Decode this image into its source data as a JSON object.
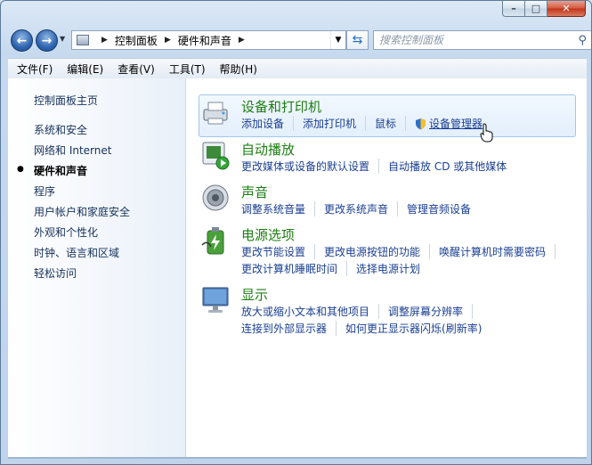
{
  "window": {
    "caption_buttons": [
      "–",
      "□",
      "✕"
    ]
  },
  "nav": {
    "back_icon": "back-arrow-icon",
    "forward_icon": "forward-arrow-icon",
    "breadcrumb": [
      "控制面板",
      "硬件和声音"
    ],
    "search_placeholder": "搜索控制面板"
  },
  "menu": [
    "文件(F)",
    "编辑(E)",
    "查看(V)",
    "工具(T)",
    "帮助(H)"
  ],
  "sidebar": {
    "home": "控制面板主页",
    "items": [
      "系统和安全",
      "网络和 Internet",
      "硬件和声音",
      "程序",
      "用户帐户和家庭安全",
      "外观和个性化",
      "时钟、语言和区域",
      "轻松访问"
    ],
    "current_index": 2
  },
  "categories": [
    {
      "title": "设备和打印机",
      "icon": "printer-icon",
      "rows": [
        [
          "添加设备",
          "添加打印机",
          "鼠标",
          "设备管理器"
        ]
      ]
    },
    {
      "title": "自动播放",
      "icon": "autoplay-icon",
      "rows": [
        [
          "更改媒体或设备的默认设置",
          "自动播放 CD 或其他媒体"
        ]
      ]
    },
    {
      "title": "声音",
      "icon": "speaker-icon",
      "rows": [
        [
          "调整系统音量",
          "更改系统声音",
          "管理音频设备"
        ]
      ]
    },
    {
      "title": "电源选项",
      "icon": "battery-icon",
      "rows": [
        [
          "更改节能设置",
          "更改电源按钮的功能",
          "唤醒计算机时需要密码"
        ],
        [
          "更改计算机睡眠时间",
          "选择电源计划"
        ]
      ]
    },
    {
      "title": "显示",
      "icon": "monitor-icon",
      "rows": [
        [
          "放大或缩小文本和其他项目",
          "调整屏幕分辨率"
        ],
        [
          "连接到外部显示器",
          "如何更正显示器闪烁(刷新率)"
        ]
      ]
    }
  ]
}
